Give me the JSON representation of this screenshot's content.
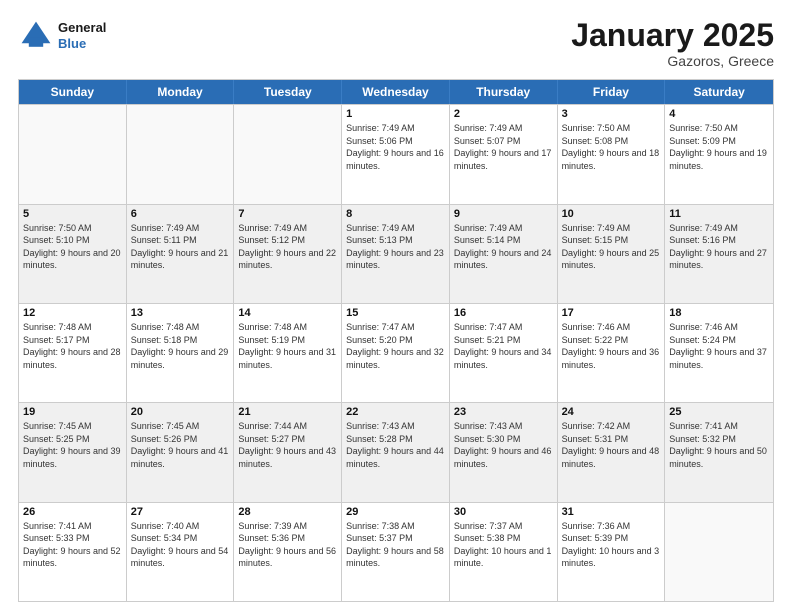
{
  "header": {
    "logo_general": "General",
    "logo_blue": "Blue",
    "month": "January 2025",
    "location": "Gazoros, Greece"
  },
  "weekdays": [
    "Sunday",
    "Monday",
    "Tuesday",
    "Wednesday",
    "Thursday",
    "Friday",
    "Saturday"
  ],
  "rows": [
    [
      {
        "day": "",
        "info": ""
      },
      {
        "day": "",
        "info": ""
      },
      {
        "day": "",
        "info": ""
      },
      {
        "day": "1",
        "info": "Sunrise: 7:49 AM\nSunset: 5:06 PM\nDaylight: 9 hours and 16 minutes."
      },
      {
        "day": "2",
        "info": "Sunrise: 7:49 AM\nSunset: 5:07 PM\nDaylight: 9 hours and 17 minutes."
      },
      {
        "day": "3",
        "info": "Sunrise: 7:50 AM\nSunset: 5:08 PM\nDaylight: 9 hours and 18 minutes."
      },
      {
        "day": "4",
        "info": "Sunrise: 7:50 AM\nSunset: 5:09 PM\nDaylight: 9 hours and 19 minutes."
      }
    ],
    [
      {
        "day": "5",
        "info": "Sunrise: 7:50 AM\nSunset: 5:10 PM\nDaylight: 9 hours and 20 minutes."
      },
      {
        "day": "6",
        "info": "Sunrise: 7:49 AM\nSunset: 5:11 PM\nDaylight: 9 hours and 21 minutes."
      },
      {
        "day": "7",
        "info": "Sunrise: 7:49 AM\nSunset: 5:12 PM\nDaylight: 9 hours and 22 minutes."
      },
      {
        "day": "8",
        "info": "Sunrise: 7:49 AM\nSunset: 5:13 PM\nDaylight: 9 hours and 23 minutes."
      },
      {
        "day": "9",
        "info": "Sunrise: 7:49 AM\nSunset: 5:14 PM\nDaylight: 9 hours and 24 minutes."
      },
      {
        "day": "10",
        "info": "Sunrise: 7:49 AM\nSunset: 5:15 PM\nDaylight: 9 hours and 25 minutes."
      },
      {
        "day": "11",
        "info": "Sunrise: 7:49 AM\nSunset: 5:16 PM\nDaylight: 9 hours and 27 minutes."
      }
    ],
    [
      {
        "day": "12",
        "info": "Sunrise: 7:48 AM\nSunset: 5:17 PM\nDaylight: 9 hours and 28 minutes."
      },
      {
        "day": "13",
        "info": "Sunrise: 7:48 AM\nSunset: 5:18 PM\nDaylight: 9 hours and 29 minutes."
      },
      {
        "day": "14",
        "info": "Sunrise: 7:48 AM\nSunset: 5:19 PM\nDaylight: 9 hours and 31 minutes."
      },
      {
        "day": "15",
        "info": "Sunrise: 7:47 AM\nSunset: 5:20 PM\nDaylight: 9 hours and 32 minutes."
      },
      {
        "day": "16",
        "info": "Sunrise: 7:47 AM\nSunset: 5:21 PM\nDaylight: 9 hours and 34 minutes."
      },
      {
        "day": "17",
        "info": "Sunrise: 7:46 AM\nSunset: 5:22 PM\nDaylight: 9 hours and 36 minutes."
      },
      {
        "day": "18",
        "info": "Sunrise: 7:46 AM\nSunset: 5:24 PM\nDaylight: 9 hours and 37 minutes."
      }
    ],
    [
      {
        "day": "19",
        "info": "Sunrise: 7:45 AM\nSunset: 5:25 PM\nDaylight: 9 hours and 39 minutes."
      },
      {
        "day": "20",
        "info": "Sunrise: 7:45 AM\nSunset: 5:26 PM\nDaylight: 9 hours and 41 minutes."
      },
      {
        "day": "21",
        "info": "Sunrise: 7:44 AM\nSunset: 5:27 PM\nDaylight: 9 hours and 43 minutes."
      },
      {
        "day": "22",
        "info": "Sunrise: 7:43 AM\nSunset: 5:28 PM\nDaylight: 9 hours and 44 minutes."
      },
      {
        "day": "23",
        "info": "Sunrise: 7:43 AM\nSunset: 5:30 PM\nDaylight: 9 hours and 46 minutes."
      },
      {
        "day": "24",
        "info": "Sunrise: 7:42 AM\nSunset: 5:31 PM\nDaylight: 9 hours and 48 minutes."
      },
      {
        "day": "25",
        "info": "Sunrise: 7:41 AM\nSunset: 5:32 PM\nDaylight: 9 hours and 50 minutes."
      }
    ],
    [
      {
        "day": "26",
        "info": "Sunrise: 7:41 AM\nSunset: 5:33 PM\nDaylight: 9 hours and 52 minutes."
      },
      {
        "day": "27",
        "info": "Sunrise: 7:40 AM\nSunset: 5:34 PM\nDaylight: 9 hours and 54 minutes."
      },
      {
        "day": "28",
        "info": "Sunrise: 7:39 AM\nSunset: 5:36 PM\nDaylight: 9 hours and 56 minutes."
      },
      {
        "day": "29",
        "info": "Sunrise: 7:38 AM\nSunset: 5:37 PM\nDaylight: 9 hours and 58 minutes."
      },
      {
        "day": "30",
        "info": "Sunrise: 7:37 AM\nSunset: 5:38 PM\nDaylight: 10 hours and 1 minute."
      },
      {
        "day": "31",
        "info": "Sunrise: 7:36 AM\nSunset: 5:39 PM\nDaylight: 10 hours and 3 minutes."
      },
      {
        "day": "",
        "info": ""
      }
    ]
  ]
}
